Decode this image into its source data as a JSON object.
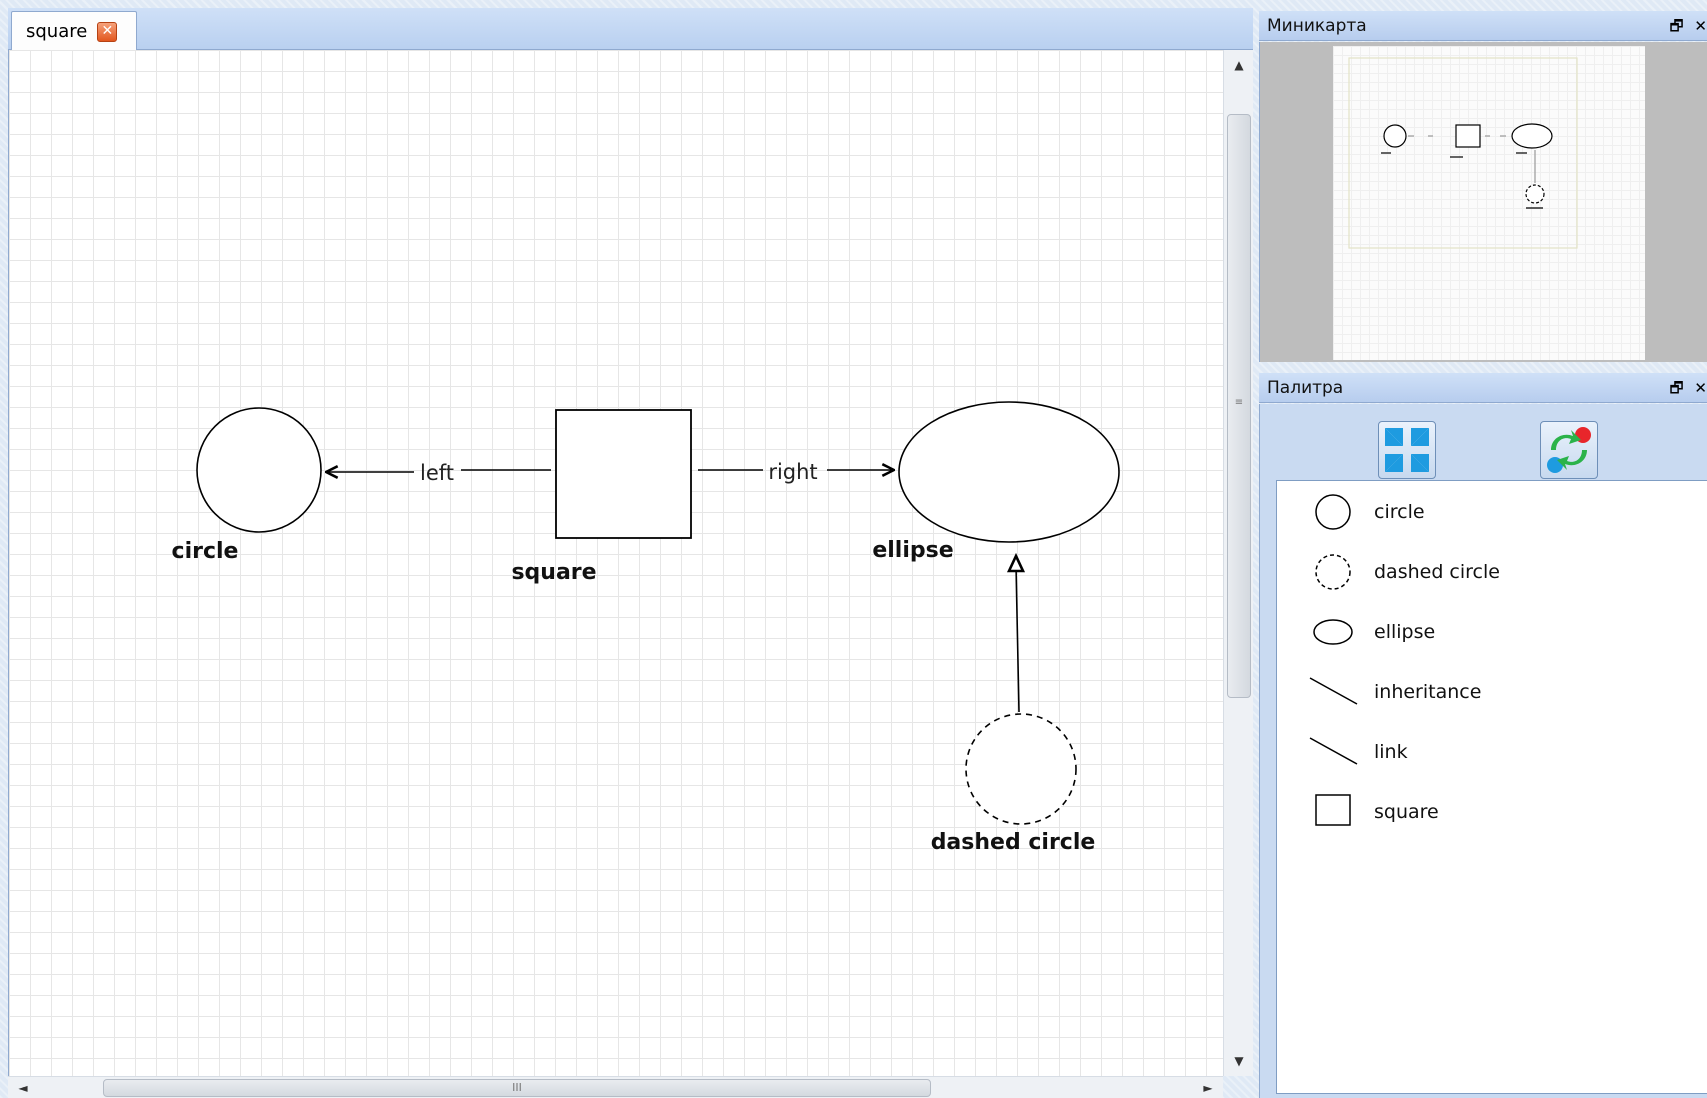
{
  "tab": {
    "label": "square",
    "close_glyph": "✕"
  },
  "diagram": {
    "nodes": [
      {
        "id": "circle",
        "label": "circle",
        "shape": "circle"
      },
      {
        "id": "square",
        "label": "square",
        "shape": "square"
      },
      {
        "id": "ellipse",
        "label": "ellipse",
        "shape": "ellipse"
      },
      {
        "id": "dashed_circle",
        "label": "dashed circle",
        "shape": "dashed-circle"
      }
    ],
    "edges": [
      {
        "from": "square",
        "to": "circle",
        "label": "left",
        "kind": "link"
      },
      {
        "from": "square",
        "to": "ellipse",
        "label": "right",
        "kind": "link"
      },
      {
        "from": "dashed_circle",
        "to": "ellipse",
        "label": "",
        "kind": "inheritance"
      }
    ]
  },
  "minimap": {
    "title": "Миникарта"
  },
  "palette": {
    "title": "Палитра",
    "tools": [
      {
        "name": "collapse-tool",
        "icon": "four-arrows-inward-icon"
      },
      {
        "name": "refresh-tool",
        "icon": "sync-arrows-icon"
      }
    ],
    "items": [
      {
        "label": "circle",
        "icon": "circle-shape-icon"
      },
      {
        "label": "dashed circle",
        "icon": "dashed-circle-shape-icon"
      },
      {
        "label": "ellipse",
        "icon": "ellipse-shape-icon"
      },
      {
        "label": "inheritance",
        "icon": "inheritance-line-icon"
      },
      {
        "label": "link",
        "icon": "link-line-icon"
      },
      {
        "label": "square",
        "icon": "square-shape-icon"
      }
    ]
  },
  "dock_buttons": {
    "restore": "🗗",
    "close": "✕"
  },
  "scroll": {
    "grip_h": "III",
    "grip_v": "≡",
    "up": "▲",
    "down": "▼",
    "left": "◄",
    "right": "►"
  },
  "colors": {
    "accent": "#c3d6f2",
    "close_button": "#e2571f"
  }
}
